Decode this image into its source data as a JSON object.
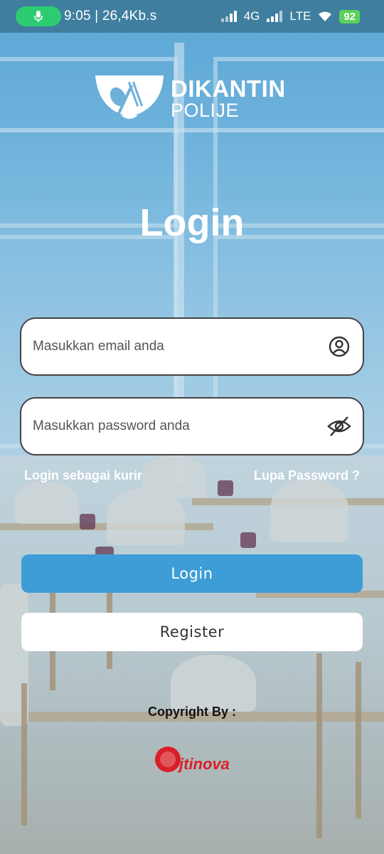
{
  "status_bar": {
    "time_speed": "9:05 | 26,4Kb.s",
    "network_1": "4G",
    "network_2": "LTE",
    "battery": "92"
  },
  "logo": {
    "line1": "DIKANTIN",
    "line2": "POLIJE"
  },
  "title": "Login",
  "email": {
    "placeholder": "Masukkan email anda",
    "value": ""
  },
  "password": {
    "placeholder": "Masukkan password anda",
    "value": ""
  },
  "links": {
    "courier": "Login sebagai kurir",
    "forgot": "Lupa Password ?"
  },
  "buttons": {
    "login": "Login",
    "register": "Register"
  },
  "footer": {
    "copyright": "Copyright By :",
    "brand": "jtinova"
  },
  "colors": {
    "primary": "#3e9dd6",
    "status_bar": "#3f7e9e",
    "brand_red": "#d91f26"
  }
}
